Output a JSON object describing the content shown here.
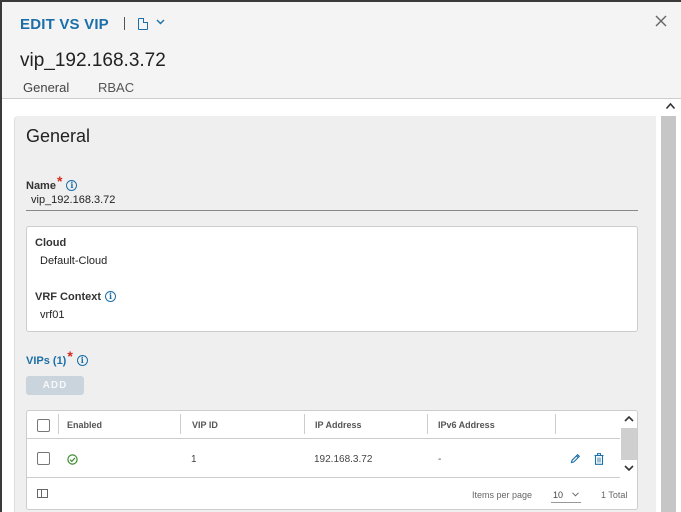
{
  "modal": {
    "title": "EDIT VS VIP",
    "object_name": "vip_192.168.3.72",
    "tabs": [
      {
        "label": "General",
        "active": true
      },
      {
        "label": "RBAC",
        "active": false
      }
    ]
  },
  "general": {
    "section_title": "General",
    "name": {
      "label": "Name",
      "required_mark": "*",
      "value": "vip_192.168.3.72"
    },
    "cloud": {
      "label": "Cloud",
      "value": "Default-Cloud"
    },
    "vrf_context": {
      "label": "VRF Context",
      "value": "vrf01"
    },
    "vips": {
      "label": "VIPs (1)",
      "required_mark": "*",
      "add_label": "ADD",
      "columns": [
        "Enabled",
        "VIP ID",
        "IP Address",
        "IPv6 Address"
      ],
      "rows": [
        {
          "enabled": true,
          "vip_id": "1",
          "ip_address": "192.168.3.72",
          "ipv6_address": "-"
        }
      ],
      "footer": {
        "items_per_page_label": "Items per page",
        "items_per_page_value": "10",
        "total": "1 Total"
      }
    }
  },
  "icons": {
    "info": "i",
    "colors": {
      "accent": "#1b6fa8",
      "required": "#d42b1e",
      "success": "#3c8a2e"
    }
  }
}
